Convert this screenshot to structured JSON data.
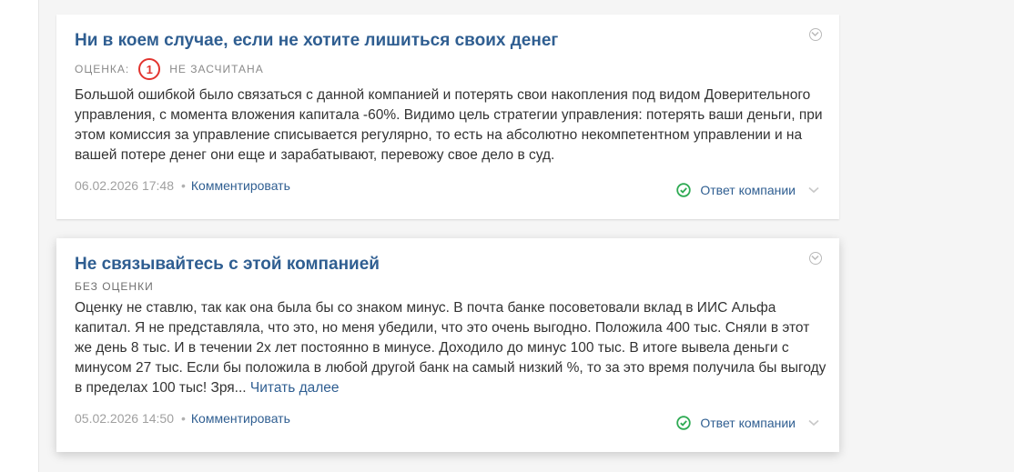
{
  "reviews": [
    {
      "title": "Ни в коем случае, если не хотите лишиться своих денег",
      "rating_label": "Оценка:",
      "rating_value": "1",
      "rating_status": "не засчитана",
      "text": "Большой ошибкой было связаться с данной компанией и потерять свои накопления под видом Доверительного управления, с момента вложения капитала -60%. Видимо цель стратегии управления: потерять ваши деньги, при этом комиссия за управление списывается регулярно, то есть на абсолютно некомпетентном управлении и на вашей потере денег они еще и зарабатывают, перевожу свое дело в суд.",
      "date": "06.02.2026 17:48",
      "dot": "•",
      "comment_label": "Комментировать",
      "company_answer_label": "Ответ компании"
    },
    {
      "title": "Не связывайтесь с этой компанией",
      "rating_label": "без оценки",
      "text": "Оценку не ставлю, так как она была бы со знаком минус. В почта банке посоветовали вклад в ИИС Альфа капитал. Я не представляла, что это, но меня убедили, что это очень выгодно. Положила 400 тыс. Сняли в этот же день 8 тыс. И в течении 2х лет постоянно в минусе. Доходило до минус 100 тыс. В итоге вывела деньги с минусом 27 тыс.  Если бы положила в любой другой банк на самый низкий %, то за это время получила бы выгоду в пределах 100 тыс! Зря...",
      "read_more_label": "Читать далее",
      "date": "05.02.2026 14:50",
      "dot": "•",
      "comment_label": "Комментировать",
      "company_answer_label": "Ответ компании"
    }
  ],
  "icons": {
    "expand": "chevron-down-circle-icon",
    "company_answer": "check-circle-icon",
    "toggle": "chevron-down-icon"
  },
  "colors": {
    "title": "#2f5e91",
    "rating_bad": "#e2342f",
    "answer_check": "#2eaa53",
    "muted": "#a0a0a0"
  }
}
